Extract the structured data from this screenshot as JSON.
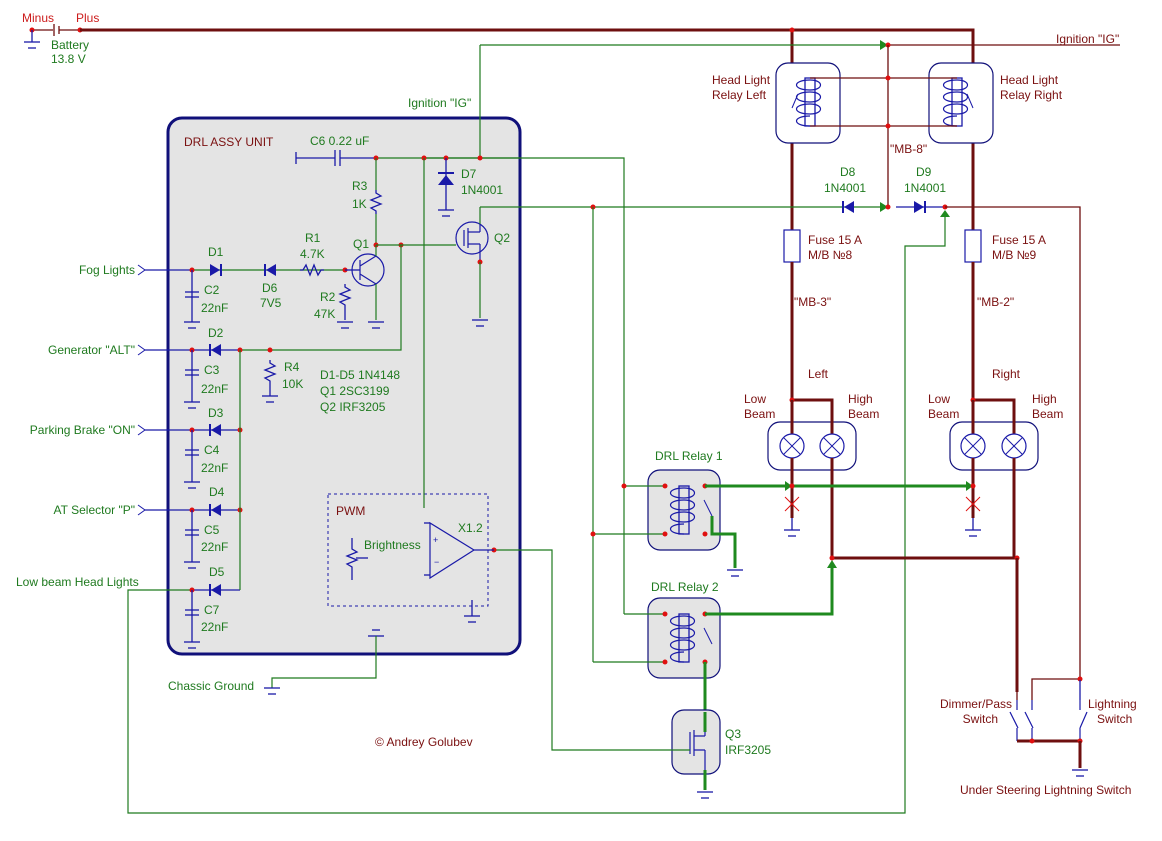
{
  "battery": {
    "minus": "Minus",
    "plus": "Plus",
    "name": "Battery",
    "voltage": "13.8 V"
  },
  "unit": {
    "title": "DRL ASSY UNIT",
    "ignition_label": "Ignition \"IG\"",
    "c6": "C6  0.22 uF",
    "r3": {
      "name": "R3",
      "value": "1K"
    },
    "d7": {
      "name": "D7",
      "value": "1N4001"
    },
    "q1": "Q1",
    "q2": "Q2",
    "r1": {
      "name": "R1",
      "value": "4.7K"
    },
    "r2": {
      "name": "R2",
      "value": "47K"
    },
    "d1": "D1",
    "d6": {
      "name": "D6",
      "value": "7V5"
    },
    "c2": {
      "name": "C2",
      "value": "22nF"
    },
    "d2": "D2",
    "c3": {
      "name": "C3",
      "value": "22nF"
    },
    "r4": {
      "name": "R4",
      "value": "10K"
    },
    "parts_note": [
      "D1-D5 1N4148",
      "Q1 2SC3199",
      "Q2 IRF3205"
    ],
    "d3": "D3",
    "c4": {
      "name": "C4",
      "value": "22nF"
    },
    "d4": "D4",
    "c5": {
      "name": "C5",
      "value": "22nF"
    },
    "d5": "D5",
    "c7": {
      "name": "C7",
      "value": "22nF"
    },
    "pwm": {
      "title": "PWM",
      "pot": "Brightness",
      "amp": "X1.2"
    }
  },
  "inputs": [
    "Fog Lights",
    "Generator \"ALT\"",
    "Parking Brake \"ON\"",
    "AT Selector \"P\"",
    "Low beam Head Lights"
  ],
  "ground_label": "Chassic Ground",
  "copyright": "© Andrey Golubev",
  "ignition_right": "Ignition \"IG\"",
  "relays": {
    "hl_left": [
      "Head Light",
      "Relay Left"
    ],
    "hl_right": [
      "Head Light",
      "Relay Right"
    ],
    "drl1": "DRL Relay 1",
    "drl2": "DRL Relay 2"
  },
  "mb8": "\"MB-8\"",
  "d8": {
    "name": "D8",
    "value": "1N4001"
  },
  "d9": {
    "name": "D9",
    "value": "1N4001"
  },
  "fuse_left": {
    "name": "Fuse 15 A",
    "ref": "M/B №8"
  },
  "fuse_right": {
    "name": "Fuse 15 A",
    "ref": "M/B №9"
  },
  "mb3": "\"MB-3\"",
  "mb2": "\"MB-2\"",
  "lamps": {
    "left": "Left",
    "right": "Right",
    "low": [
      "Low",
      "Beam"
    ],
    "high": [
      "High",
      "Beam"
    ]
  },
  "q3": {
    "name": "Q3",
    "value": "IRF3205"
  },
  "switches": {
    "dimmer": [
      "Dimmer/Pass",
      "Switch"
    ],
    "lightning": [
      "Lightning",
      "Switch"
    ],
    "caption": "Under Steering Lightning Switch"
  }
}
